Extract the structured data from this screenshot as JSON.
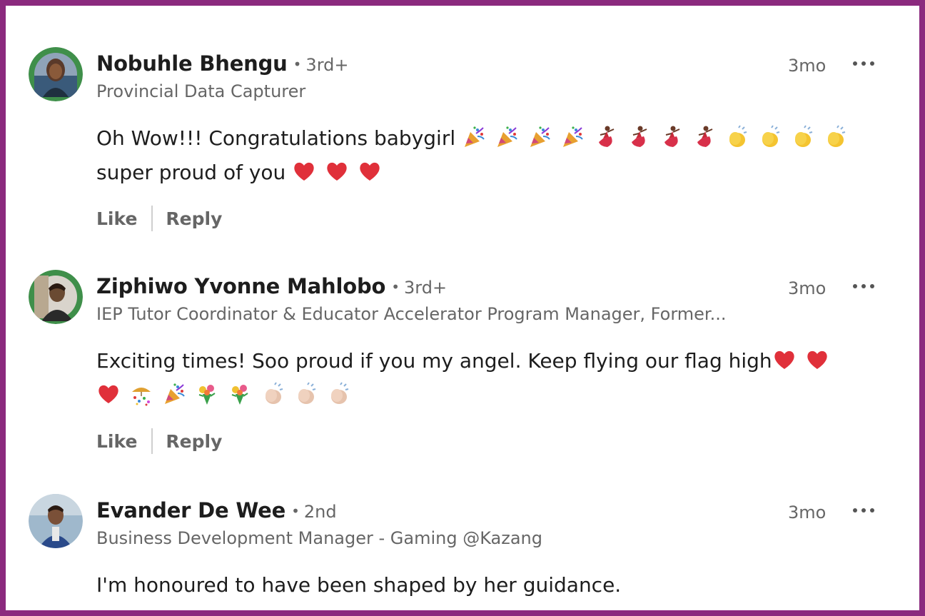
{
  "comments": [
    {
      "name": "Nobuhle Bhengu",
      "degree": "3rd+",
      "headline": "Provincial Data Capturer",
      "time": "3mo",
      "text_line1": "Oh Wow!!! Congratulations babygirl",
      "line1_emojis": [
        "party-popper-icon",
        "party-popper-icon",
        "party-popper-icon",
        "party-popper-icon",
        "dancer-icon",
        "dancer-icon",
        "dancer-icon",
        "dancer-icon",
        "clap-icon",
        "clap-icon",
        "clap-icon",
        "clap-icon"
      ],
      "text_line2": "super proud of you",
      "line2_emojis": [
        "heart-icon",
        "heart-icon",
        "heart-icon"
      ],
      "like": "Like",
      "reply": "Reply"
    },
    {
      "name": "Ziphiwo Yvonne Mahlobo",
      "degree": "3rd+",
      "headline": "IEP Tutor Coordinator & Educator Accelerator Program Manager, Former...",
      "time": "3mo",
      "text_line1": "Exciting times! Soo proud if you my angel. Keep flying our flag high",
      "line1_emojis": [
        "heart-icon",
        "heart-icon"
      ],
      "text_line2": "",
      "line2_emojis": [
        "heart-icon",
        "confetti-ball-icon",
        "party-popper-icon",
        "bouquet-icon",
        "bouquet-icon",
        "clap-light-icon",
        "clap-light-icon",
        "clap-light-icon"
      ],
      "like": "Like",
      "reply": "Reply"
    },
    {
      "name": "Evander De Wee",
      "degree": "2nd",
      "headline": "Business Development Manager - Gaming @Kazang",
      "time": "3mo",
      "text_line1": "I'm honoured to have been shaped by her guidance.",
      "line1_emojis": [],
      "text_line2": "",
      "line2_emojis": []
    }
  ],
  "colors": {
    "frame": "#8b2a7e",
    "muted": "#666666",
    "text": "#1d1d1d",
    "heart": "#e0303a"
  }
}
